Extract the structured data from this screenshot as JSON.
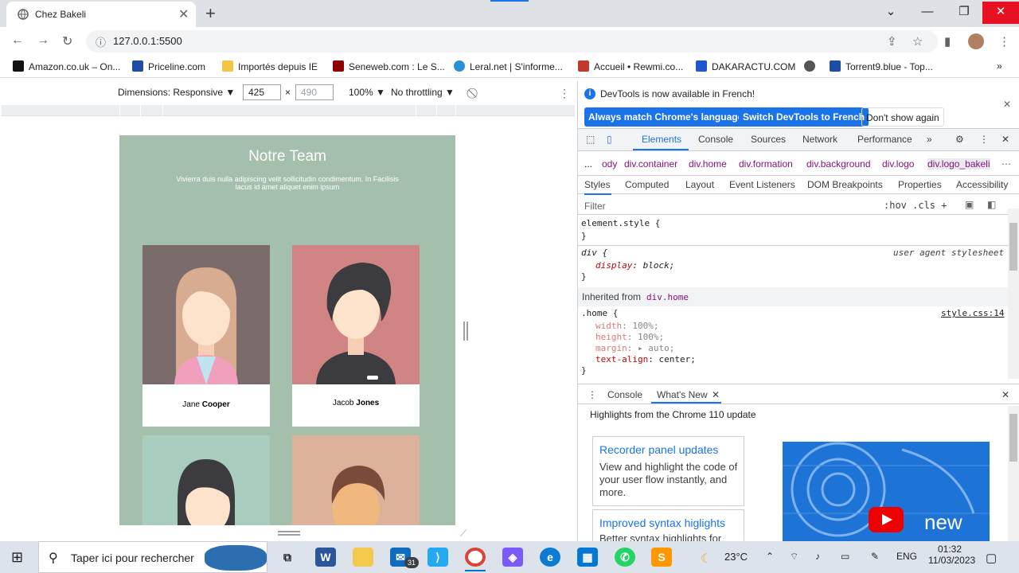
{
  "browser": {
    "tab_title": "Chez Bakeli",
    "url": "127.0.0.1:5500",
    "bookmarks": [
      {
        "label": "Amazon.co.uk – On...",
        "color": "#111111"
      },
      {
        "label": "Priceline.com",
        "color": "#1d4ea3"
      },
      {
        "label": "Importés depuis IE",
        "color": "#f4c542"
      },
      {
        "label": "Seneweb.com : Le S...",
        "color": "#8b0000"
      },
      {
        "label": "Leral.net | S'informe...",
        "color": "#2a8fd4"
      },
      {
        "label": "Accueil • Rewmi.co...",
        "color": "#c0392b"
      },
      {
        "label": "DAKARACTU.COM",
        "color": "#2255cc"
      },
      {
        "label": "",
        "color": "#555555"
      },
      {
        "label": "Torrent9.blue - Top...",
        "color": "#1d4ea3"
      }
    ]
  },
  "device_toolbar": {
    "dimensions_label": "Dimensions: Responsive ▼",
    "width": "425",
    "x": "×",
    "height": "490",
    "zoom": "100% ▼",
    "throttling": "No throttling ▼"
  },
  "emulated_page": {
    "title": "Notre Team",
    "description": "Vivierra duis nulla adipiscing velit sollicitudin condimentum. In Facilisis lacus id amet aliquet enim ipsum",
    "members": [
      {
        "first": "Jane",
        "last": "Cooper",
        "bg": "#7c6b6b"
      },
      {
        "first": "Jacob",
        "last": "Jones",
        "bg": "#d18484"
      },
      {
        "first": "",
        "last": "",
        "bg": "#a8ccbd"
      },
      {
        "first": "",
        "last": "",
        "bg": "#dcb39a"
      }
    ]
  },
  "devtools": {
    "info_text": "DevTools is now available in French!",
    "btn_match": "Always match Chrome's language",
    "btn_switch": "Switch DevTools to French",
    "btn_dont": "Don't show again",
    "tabs": [
      "Elements",
      "Console",
      "Sources",
      "Network",
      "Performance"
    ],
    "breadcrumbs": [
      "...",
      "ody",
      "div.container",
      "div.home",
      "div.formation",
      "div.background",
      "div.logo",
      "div.logo_bakeli"
    ],
    "side_tabs": [
      "Styles",
      "Computed",
      "Layout",
      "Event Listeners",
      "DOM Breakpoints",
      "Properties",
      "Accessibility"
    ],
    "filter_placeholder": "Filter",
    "filter_tools": ":hov  .cls  +",
    "element_style": "element.style {",
    "close_brace": "}",
    "ua_selector": "div {",
    "ua_label": "user agent stylesheet",
    "ua_prop": "display",
    "ua_val": "block;",
    "inherited_label": "Inherited from",
    "inherited_from": "div.home",
    "home_selector": ".home {",
    "home_source": "style.css:14",
    "home_props": [
      {
        "p": "width",
        "v": "100%;"
      },
      {
        "p": "height",
        "v": "100%;"
      },
      {
        "p": "margin",
        "v": "▸ auto;"
      },
      {
        "p": "text-align",
        "v": "center;"
      }
    ],
    "drawer_tabs": [
      "Console",
      "What's New"
    ],
    "drawer_headline": "Highlights from the Chrome 110 update",
    "wn1_title": "Recorder panel updates",
    "wn1_body": "View and highlight the code of your user flow instantly, and more.",
    "wn2_title": "Improved syntax higlights",
    "wn2_body": "Better syntax highlights for",
    "video_text": "new"
  },
  "taskbar": {
    "search_placeholder": "Taper ici pour rechercher",
    "temperature": "23°C",
    "lang": "ENG",
    "time": "01:32",
    "date": "11/03/2023",
    "mail_badge": "31"
  }
}
